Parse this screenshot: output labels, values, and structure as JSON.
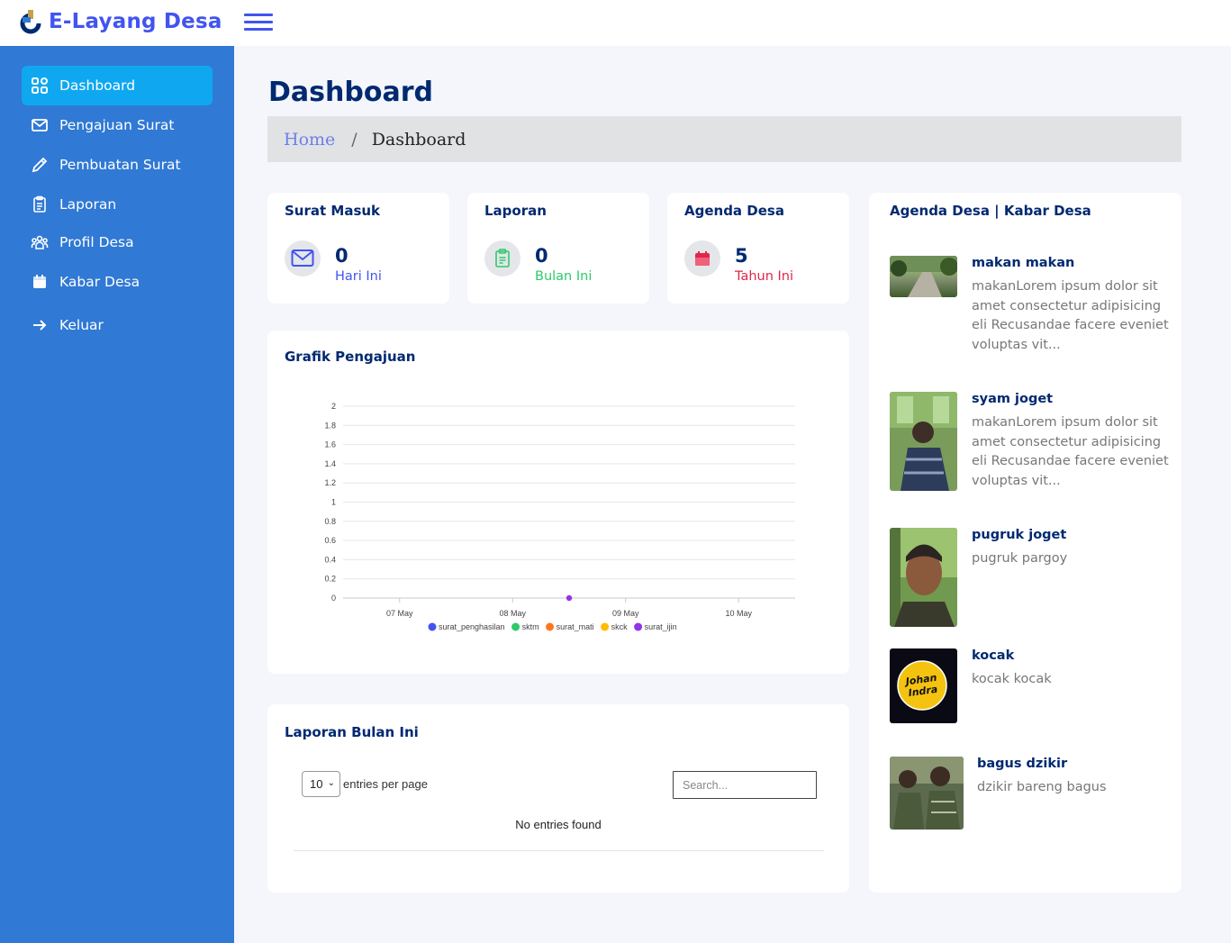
{
  "app": {
    "title": "E-Layang Desa"
  },
  "sidebar": {
    "items": [
      {
        "label": "Dashboard",
        "icon": "grid-icon"
      },
      {
        "label": "Pengajuan Surat",
        "icon": "envelope-icon"
      },
      {
        "label": "Pembuatan Surat",
        "icon": "pencil-icon"
      },
      {
        "label": "Laporan",
        "icon": "clipboard-icon"
      },
      {
        "label": "Profil Desa",
        "icon": "people-icon"
      },
      {
        "label": "Kabar Desa",
        "icon": "calendar-icon"
      },
      {
        "label": "Keluar",
        "icon": "arrow-right-icon"
      }
    ]
  },
  "page": {
    "title": "Dashboard"
  },
  "breadcrumb": {
    "home": "Home",
    "separator": "/",
    "current": "Dashboard"
  },
  "stats": [
    {
      "title": "Surat Masuk",
      "value": "0",
      "sub": "Hari Ini",
      "icon": "envelope-icon",
      "color": "#4154f1"
    },
    {
      "title": "Laporan",
      "value": "0",
      "sub": "Bulan Ini",
      "icon": "clipboard-icon",
      "color": "#2eca6a"
    },
    {
      "title": "Agenda Desa",
      "value": "5",
      "sub": "Tahun Ini",
      "icon": "calendar-icon",
      "color": "#e0264a"
    }
  ],
  "chart_card": {
    "title": "Grafik Pengajuan"
  },
  "chart_data": {
    "type": "line",
    "title": "",
    "xlabel": "",
    "ylabel": "",
    "x": [
      "07 May",
      "08 May",
      "09 May",
      "10 May"
    ],
    "y_ticks": [
      "0",
      "0.2",
      "0.4",
      "0.6",
      "0.8",
      "1",
      "1.2",
      "1.4",
      "1.6",
      "1.8",
      "2"
    ],
    "ylim": [
      0,
      2
    ],
    "grid": true,
    "legend_position": "bottom",
    "series": [
      {
        "name": "surat_penghasilan",
        "color": "#4154f1",
        "points": []
      },
      {
        "name": "sktm",
        "color": "#2eca6a",
        "points": []
      },
      {
        "name": "surat_mati",
        "color": "#ff771d",
        "points": []
      },
      {
        "name": "skck",
        "color": "#ffbb00",
        "points": []
      },
      {
        "name": "surat_ijin",
        "color": "#9333ea",
        "points": [
          {
            "x": "08 May 12:00",
            "y": 0
          }
        ]
      }
    ]
  },
  "table_card": {
    "title": "Laporan Bulan Ini",
    "page_size": "10",
    "entries_label": "entries per page",
    "search_placeholder": "Search...",
    "empty": "No entries found"
  },
  "news": {
    "title": "Agenda Desa | Kabar Desa",
    "items": [
      {
        "title": "makan makan",
        "desc": "makanLorem ipsum dolor sit amet consectetur adipisicing eli Recusandae facere eveniet voluptas vit..."
      },
      {
        "title": "syam joget",
        "desc": "makanLorem ipsum dolor sit amet consectetur adipisicing eli Recusandae facere eveniet voluptas vit..."
      },
      {
        "title": "pugruk joget",
        "desc": "pugruk pargoy"
      },
      {
        "title": "kocak",
        "desc": "kocak kocak",
        "thumb_text": "Johan Indra"
      },
      {
        "title": "bagus dzikir",
        "desc": "dzikir bareng bagus"
      }
    ]
  }
}
